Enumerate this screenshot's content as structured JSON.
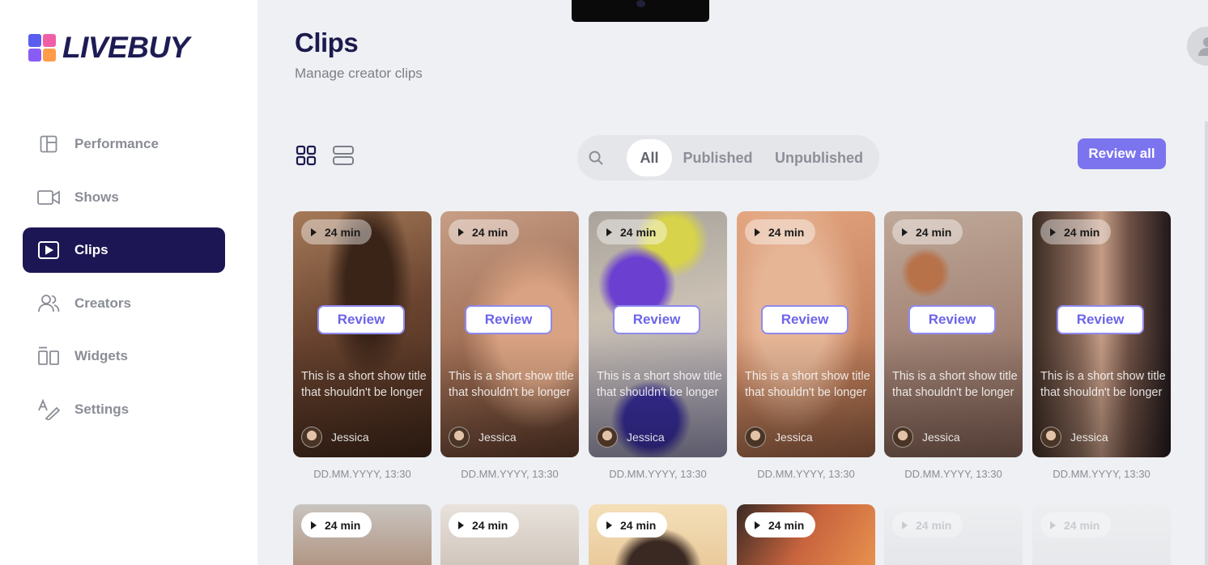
{
  "brand": {
    "name": "LIVEBUY",
    "mark_colors": [
      "#5a5ef0",
      "#ef5fa7",
      "#ff9c4a",
      "#8a5cf6"
    ]
  },
  "nav": [
    {
      "label": "Performance",
      "icon": "layout-icon",
      "active": false
    },
    {
      "label": "Shows",
      "icon": "video-camera-icon",
      "active": false
    },
    {
      "label": "Clips",
      "icon": "play-square-icon",
      "active": true
    },
    {
      "label": "Creators",
      "icon": "users-icon",
      "active": false
    },
    {
      "label": "Widgets",
      "icon": "widgets-icon",
      "active": false
    },
    {
      "label": "Settings",
      "icon": "settings-pen-icon",
      "active": false
    }
  ],
  "header": {
    "title": "Clips",
    "subtitle": "Manage creator clips"
  },
  "toolbar": {
    "view_grid_icon": "grid-view-icon",
    "view_list_icon": "list-view-icon",
    "search_icon": "search-icon",
    "filters": [
      "All",
      "Published",
      "Unpublished"
    ],
    "active_filter": "All",
    "review_all_label": "Review all"
  },
  "colors": {
    "accent": "#7b74ee",
    "nav_active": "#1c1654",
    "title": "#1c1a4d"
  },
  "clips": [
    {
      "duration": "24 min",
      "review_label": "Review",
      "title": "This is a short show title that shouldn't be longer",
      "creator": "Jessica",
      "date": "DD.MM.YYYY, 13:30"
    },
    {
      "duration": "24 min",
      "review_label": "Review",
      "title": "This is a short show title that shouldn't be longer",
      "creator": "Jessica",
      "date": "DD.MM.YYYY, 13:30"
    },
    {
      "duration": "24 min",
      "review_label": "Review",
      "title": "This is a short show title that shouldn't be longer",
      "creator": "Jessica",
      "date": "DD.MM.YYYY, 13:30"
    },
    {
      "duration": "24 min",
      "review_label": "Review",
      "title": "This is a short show title that shouldn't be longer",
      "creator": "Jessica",
      "date": "DD.MM.YYYY, 13:30"
    },
    {
      "duration": "24 min",
      "review_label": "Review",
      "title": "This is a short show title that shouldn't be longer",
      "creator": "Jessica",
      "date": "DD.MM.YYYY, 13:30"
    },
    {
      "duration": "24 min",
      "review_label": "Review",
      "title": "This is a short show title that shouldn't be longer",
      "creator": "Jessica",
      "date": "DD.MM.YYYY, 13:30"
    }
  ],
  "clips_row2": [
    {
      "duration": "24 min"
    },
    {
      "duration": "24 min"
    },
    {
      "duration": "24 min"
    },
    {
      "duration": "24 min"
    },
    {
      "duration": "24 min"
    },
    {
      "duration": "24 min"
    }
  ]
}
